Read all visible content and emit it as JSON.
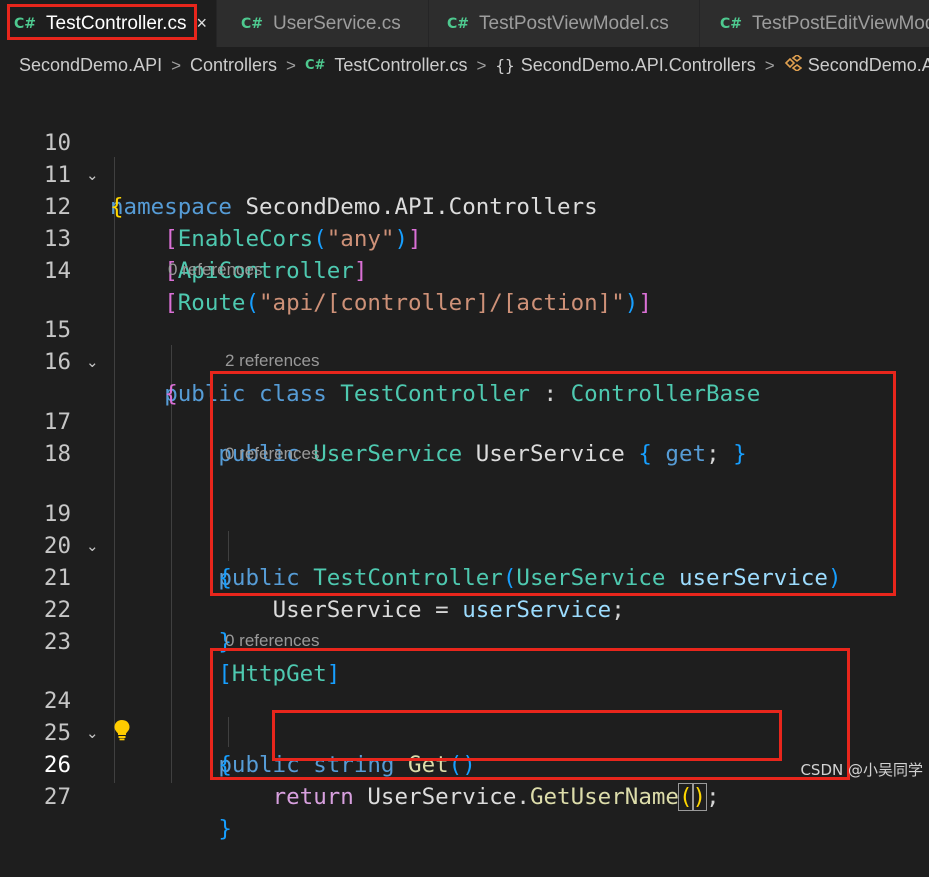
{
  "tabs": [
    {
      "icon": "C#",
      "label": "TestController.cs",
      "active": true,
      "close": "×"
    },
    {
      "icon": "C#",
      "label": "UserService.cs",
      "active": false
    },
    {
      "icon": "C#",
      "label": "TestPostViewModel.cs",
      "active": false
    },
    {
      "icon": "C#",
      "label": "TestPostEditViewModel.cs",
      "active": false
    }
  ],
  "breadcrumb": {
    "project": "SecondDemo.API",
    "folder": "Controllers",
    "file_icon": "C#",
    "file": "TestController.cs",
    "namespace_icon": "{}",
    "namespace": "SecondDemo.API.Controllers",
    "class_icon": "class-icon",
    "class": "SecondDemo.API.Controllers.TestController",
    "separator": ">"
  },
  "editor": {
    "line_numbers": [
      "10",
      "11",
      "12",
      "13",
      "14",
      "15",
      "16",
      "17",
      "18",
      "19",
      "20",
      "21",
      "22",
      "23",
      "24",
      "25",
      "26",
      "27"
    ],
    "codelens": {
      "before_15": "0 references",
      "before_17": "2 references",
      "before_19": "0 references",
      "before_24": "0 references"
    },
    "current_line": "26",
    "lightbulb_icon": "lightbulb-icon"
  },
  "colors": {
    "highlight_box": "#e8261c",
    "background": "#1e1e1e",
    "keyword": "#569cd6",
    "type": "#4ec9b0",
    "string": "#ce9178"
  },
  "watermark": "CSDN @小吴同学"
}
